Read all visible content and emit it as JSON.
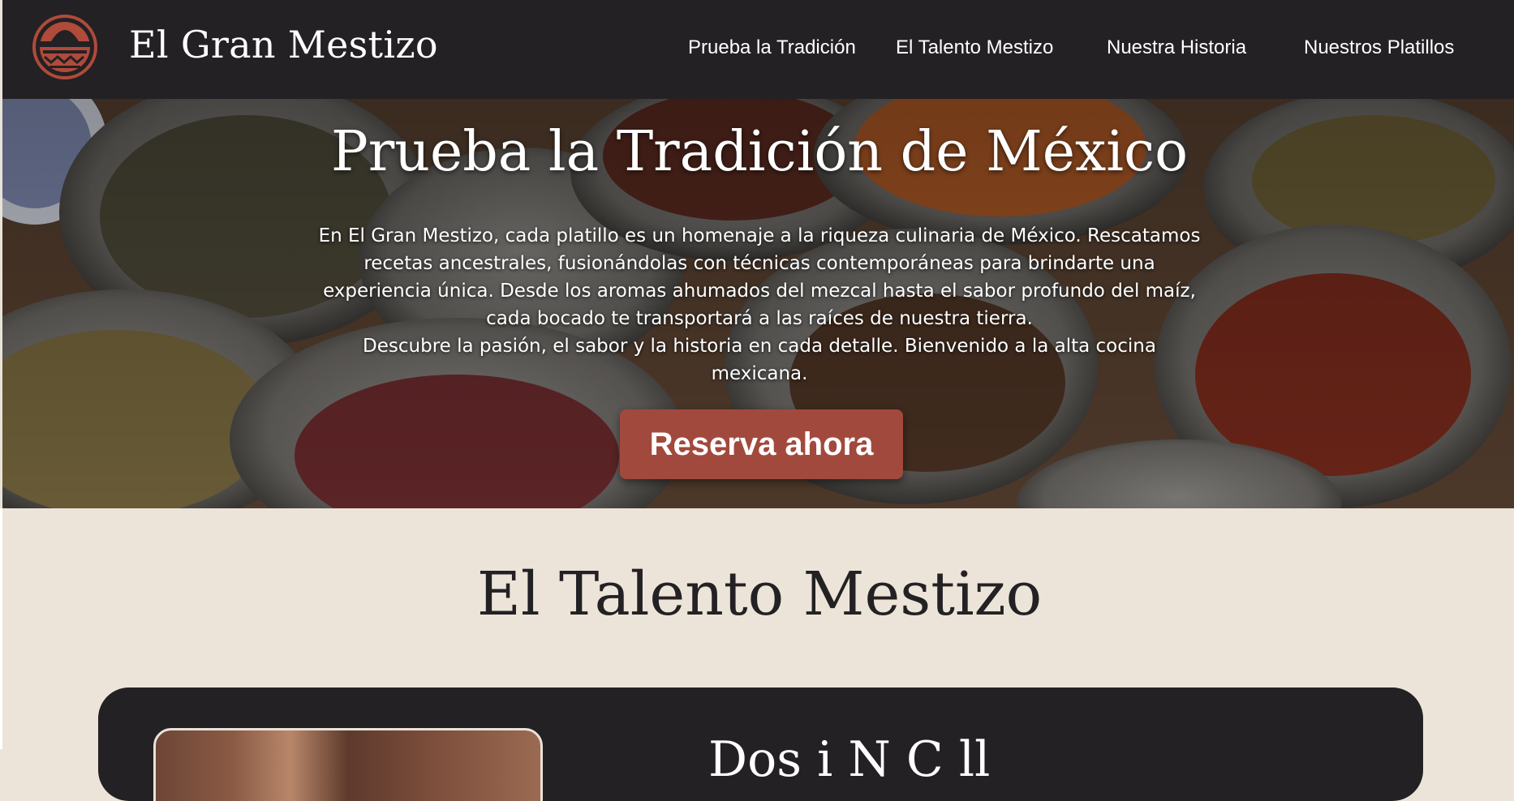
{
  "header": {
    "brand": "El Gran Mestizo",
    "logo_icon": "sombrero-logo-icon",
    "nav": [
      {
        "label": "Prueba la Tradición"
      },
      {
        "label": "El Talento Mestizo"
      },
      {
        "label": "Nuestra Historia"
      },
      {
        "label": "Nuestros Platillos"
      }
    ]
  },
  "hero": {
    "title": "Prueba la Tradición de México",
    "paragraph1": "En El Gran Mestizo, cada platillo es un homenaje a la riqueza culinaria de México. Rescatamos recetas ancestrales, fusionándolas con técnicas contemporáneas para brindarte una experiencia única. Desde los aromas ahumados del mezcal hasta el sabor profundo del maíz, cada bocado te transportará a las raíces de nuestra tierra.",
    "paragraph2": "Descubre la pasión, el sabor y la historia en cada detalle. Bienvenido a la alta cocina mexicana.",
    "cta_label": "Reserva ahora"
  },
  "talent": {
    "title": "El Talento Mestizo",
    "card_name_partial": "Dos i N C ll"
  },
  "colors": {
    "header_bg": "#232123",
    "accent": "#a2493d",
    "section_bg": "#ede4d9"
  }
}
